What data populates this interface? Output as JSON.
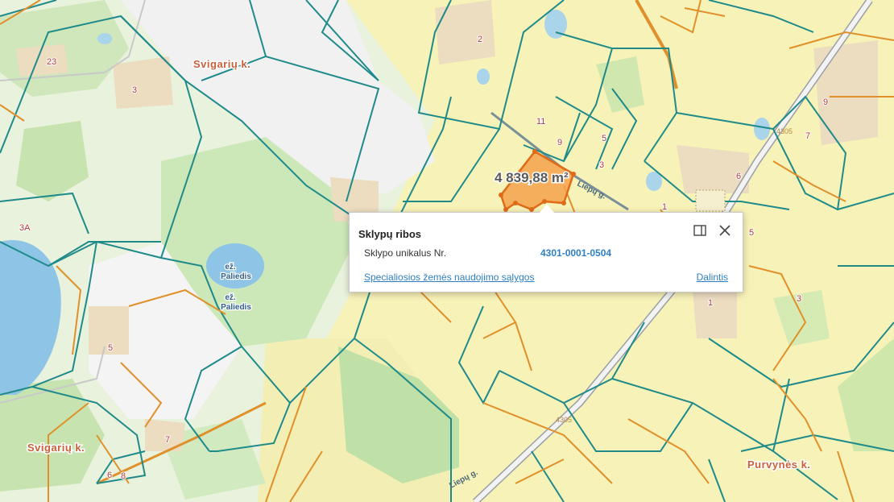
{
  "map": {
    "area_label": "4 839,88 m²",
    "villages": [
      "Svigarių k.",
      "Svigarių k.",
      "Purvynės k."
    ],
    "lake_labels": [
      "ež. Paliedis",
      "ež. Paliedis"
    ],
    "lake_prefix": "ež.",
    "lake_name": "Paliedis",
    "street_labels": [
      "Liepų g.",
      "Liepų g."
    ],
    "road_numbers": [
      "4305",
      "4305"
    ],
    "plot_numbers": [
      "23",
      "3",
      "2",
      "11",
      "9",
      "5",
      "3",
      "1",
      "9",
      "7",
      "6",
      "5",
      "3A",
      "5",
      "7",
      "6",
      "8",
      "1",
      "3"
    ]
  },
  "popup": {
    "title": "Sklypų ribos",
    "field_label": "Sklypo unikalus Nr.",
    "field_value": "4301-0001-0504",
    "link_special": "Specialiosios žemės naudojimo sąlygos",
    "link_share": "Dalintis",
    "dock_icon": "dock-panel-icon",
    "close_icon": "close-icon"
  },
  "colors": {
    "parcel_green": "#1f8a8a",
    "parcel_orange": "#e0902a",
    "selected_fill": "#f4a24a",
    "link": "#2e7fc4",
    "water": "#8ec4e6"
  }
}
